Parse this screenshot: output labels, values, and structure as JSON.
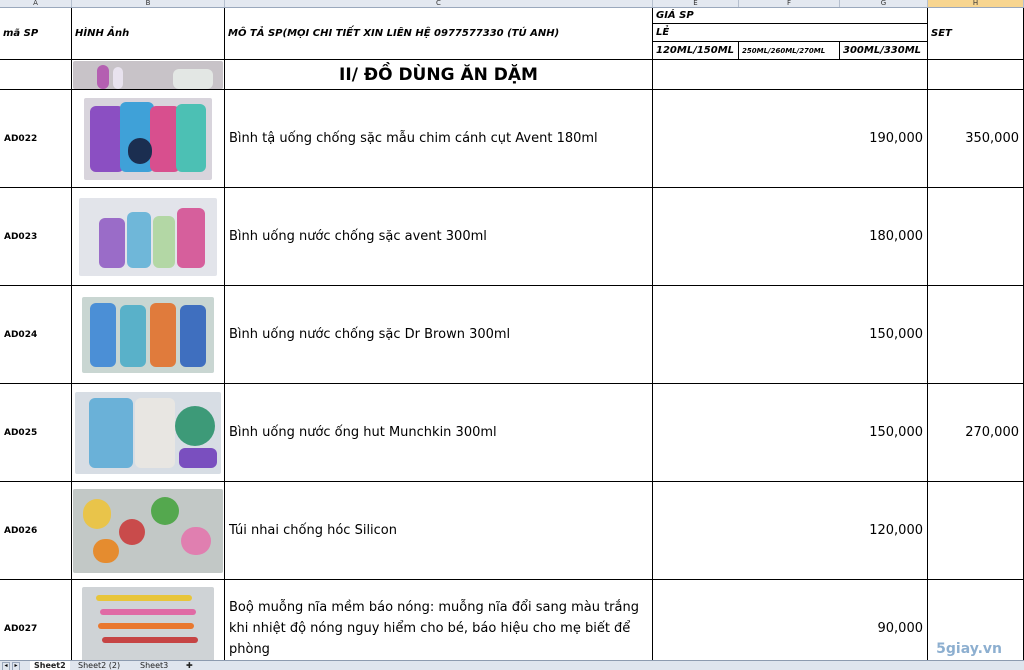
{
  "column_headers": [
    "A",
    "B",
    "C",
    "E",
    "F",
    "G",
    "H"
  ],
  "header": {
    "code_label": "mã SP",
    "image_label": "HÌNH Ảnh",
    "desc_label": "MÔ TẢ SP(MỌI CHI TIẾT XIN LIÊN HỆ 0977577330 (TÚ ANH)",
    "price_label": "GIÁ SP",
    "retail_label": "LẺ",
    "size1_label": "120ML/150ML",
    "size2_label": "250ML/260ML/270ML",
    "size3_label": "300ML/330ML",
    "set_label": "SET"
  },
  "section_title": "II/ ĐỒ DÙNG ĂN DẶM",
  "rows": [
    {
      "code": "AD022",
      "desc": "Bình tậ uống chống sặc mẫu chim cánh cụt Avent 180ml",
      "price": "190,000",
      "set": "350,000",
      "image": "sippy-cups-photo"
    },
    {
      "code": "AD023",
      "desc": "Bình uống nước chống sặc avent 300ml",
      "price": "180,000",
      "set": "",
      "image": "water-bottles-photo"
    },
    {
      "code": "AD024",
      "desc": "Bình uống nước chống sặc Dr Brown 300ml",
      "price": "150,000",
      "set": "",
      "image": "dr-brown-cups-photo"
    },
    {
      "code": "AD025",
      "desc": "Bình uống nước ống hut Munchkin 300ml",
      "price": "150,000",
      "set": "270,000",
      "image": "munchkin-cups-photo"
    },
    {
      "code": "AD026",
      "desc": "Túi nhai chống hóc Silicon",
      "price": "120,000",
      "set": "",
      "image": "feeder-bags-photo"
    },
    {
      "code": "AD027",
      "desc": "Boộ muỗng nĩa mềm báo nóng: muỗng nĩa đổi sang màu trắng khi nhiệt độ nóng nguy hiểm cho bé, báo hiệu cho mẹ biết để phòng",
      "price": "90,000",
      "set": "",
      "image": "spoons-photo"
    }
  ],
  "sheet_tabs": [
    "Sheet2",
    "Sheet2 (2)",
    "Sheet3"
  ],
  "active_sheet": "Sheet2",
  "watermark": "5giay.vn"
}
